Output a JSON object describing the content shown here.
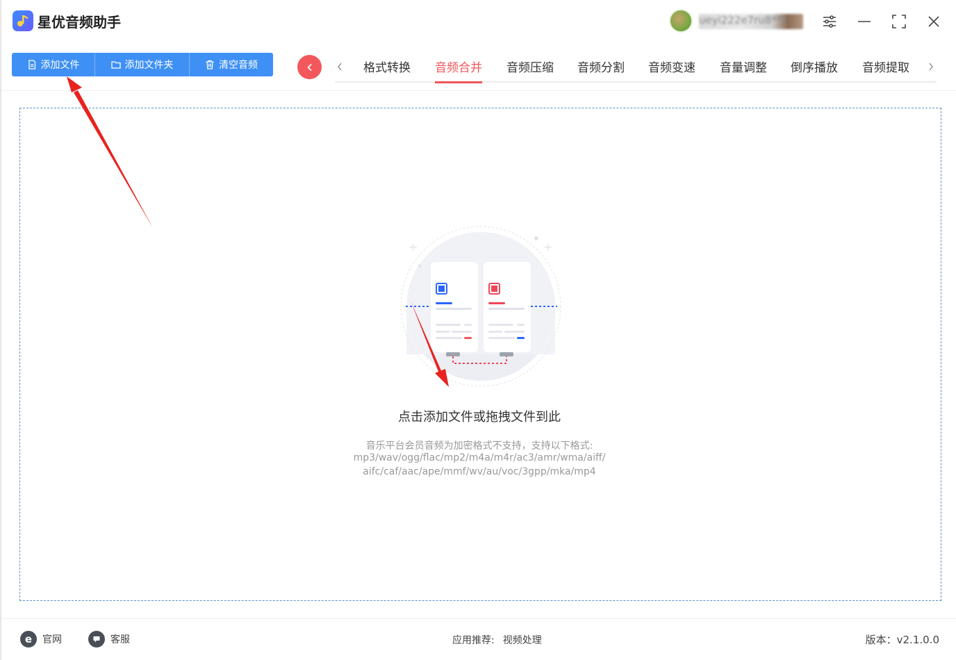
{
  "app": {
    "title": "星优音频助手",
    "username": "ueyi222e7ru8***"
  },
  "toolbar": {
    "add_file": "添加文件",
    "add_folder": "添加文件夹",
    "clear_audio": "清空音频"
  },
  "tabs": [
    {
      "label": "格式转换",
      "active": false
    },
    {
      "label": "音频合并",
      "active": true
    },
    {
      "label": "音频压缩",
      "active": false
    },
    {
      "label": "音频分割",
      "active": false
    },
    {
      "label": "音频变速",
      "active": false
    },
    {
      "label": "音量调整",
      "active": false
    },
    {
      "label": "倒序播放",
      "active": false
    },
    {
      "label": "音频提取",
      "active": false
    }
  ],
  "dropzone": {
    "title": "点击添加文件或拖拽文件到此",
    "hint_line1": "音乐平台会员音频为加密格式不支持，支持以下格式:",
    "hint_line2": "mp3/wav/ogg/flac/mp2/m4a/m4r/ac3/amr/wma/aiff/",
    "hint_line3": "aifc/caf/aac/ape/mmf/wv/au/voc/3gpp/mka/mp4"
  },
  "footer": {
    "website": "官网",
    "support": "客服",
    "recommend_label": "应用推荐:",
    "recommend_link": "视频处理",
    "version": "版本：v2.1.0.0"
  },
  "colors": {
    "accent_blue": "#3e90f5",
    "accent_red": "#f0565b",
    "annotation_red": "#e8231f"
  }
}
